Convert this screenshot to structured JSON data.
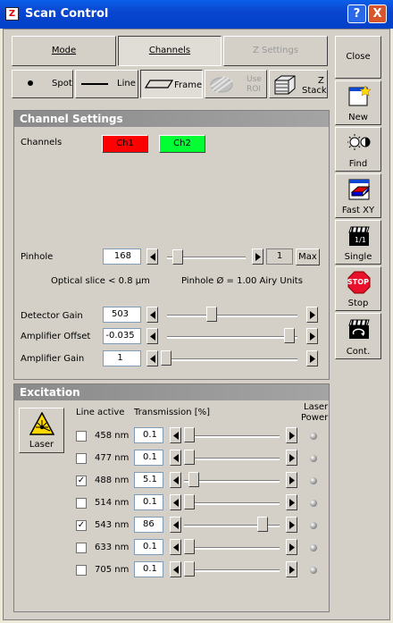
{
  "window": {
    "title": "Scan Control",
    "help": "?",
    "close": "X"
  },
  "tabs": {
    "mode": "Mode",
    "channels": "Channels",
    "zsettings": "Z Settings"
  },
  "scan_modes": {
    "spot": "Spot",
    "line": "Line",
    "frame": "Frame",
    "use_roi_1": "Use",
    "use_roi_2": "ROI",
    "zstack_1": "Z",
    "zstack_2": "Stack"
  },
  "sidebar": {
    "close": "Close",
    "new": "New",
    "find": "Find",
    "fastxy": "Fast XY",
    "single": "Single",
    "stop": "Stop",
    "stop_sign": "STOP",
    "cont": "Cont."
  },
  "channel_settings": {
    "title": "Channel Settings",
    "channels_label": "Channels",
    "ch1": "Ch1",
    "ch2": "Ch2",
    "pinhole_label": "Pinhole",
    "pinhole_value": "168",
    "pinhole_step": "1",
    "pinhole_max": "Max",
    "pinhole_level": 0.05,
    "optical_slice": "Optical slice < 0.8 µm",
    "pinhole_airy": "Pinhole Ø = 1.00 Airy Units",
    "detector_gain_label": "Detector Gain",
    "detector_gain": "503",
    "detector_gain_level": 0.33,
    "amp_offset_label": "Amplifier Offset",
    "amp_offset": "-0.035",
    "amp_offset_level": 0.98,
    "amp_gain_label": "Amplifier Gain",
    "amp_gain": "1",
    "amp_gain_level": 0.0
  },
  "excitation": {
    "title": "Excitation",
    "laser_button": "Laser",
    "line_active_header": "Line active",
    "transmission_header": "Transmission [%]",
    "laser_power_header_1": "Laser",
    "laser_power_header_2": "Power",
    "lines": [
      {
        "label": "458 nm",
        "checked": false,
        "value": "0.1",
        "level": 0.0
      },
      {
        "label": "477 nm",
        "checked": false,
        "value": "0.1",
        "level": 0.0
      },
      {
        "label": "488 nm",
        "checked": true,
        "value": "5.1",
        "level": 0.05
      },
      {
        "label": "514 nm",
        "checked": false,
        "value": "0.1",
        "level": 0.0
      },
      {
        "label": "543 nm",
        "checked": true,
        "value": "86",
        "level": 0.86
      },
      {
        "label": "633 nm",
        "checked": false,
        "value": "0.1",
        "level": 0.0
      },
      {
        "label": "705 nm",
        "checked": false,
        "value": "0.1",
        "level": 0.0
      }
    ],
    "check_mark": "✓"
  },
  "colors": {
    "ch1": "#ff0000",
    "ch2": "#00ff33",
    "title_blue": "#0a4fd8",
    "stop_red": "#e8102a"
  }
}
